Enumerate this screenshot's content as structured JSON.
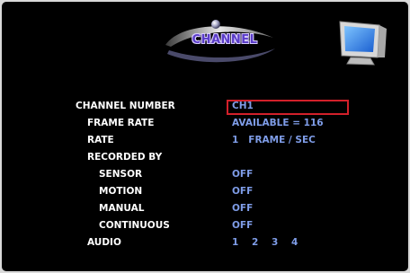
{
  "header": {
    "title": "CHANNEL",
    "icon": "monitor-icon"
  },
  "settings": [
    {
      "key": "channel_number",
      "label": "CHANNEL NUMBER",
      "value": "CH1"
    },
    {
      "key": "frame_rate",
      "label": "FRAME RATE",
      "value": "AVAILABLE = 116"
    },
    {
      "key": "rate",
      "label": "RATE",
      "value": "1   FRAME / SEC"
    },
    {
      "key": "recorded_by",
      "label": "RECORDED BY",
      "value": ""
    },
    {
      "key": "sensor",
      "label": "SENSOR",
      "value": "OFF"
    },
    {
      "key": "motion",
      "label": "MOTION",
      "value": "OFF"
    },
    {
      "key": "manual",
      "label": "MANUAL",
      "value": "OFF"
    },
    {
      "key": "continuous",
      "label": "CONTINUOUS",
      "value": "OFF"
    },
    {
      "key": "audio",
      "label": "AUDIO",
      "value": ""
    }
  ],
  "audio_channels": [
    "1",
    "2",
    "3",
    "4"
  ],
  "colors": {
    "background": "#000000",
    "label": "#ffffff",
    "value": "#7f9de8",
    "selection": "#d2202a"
  }
}
